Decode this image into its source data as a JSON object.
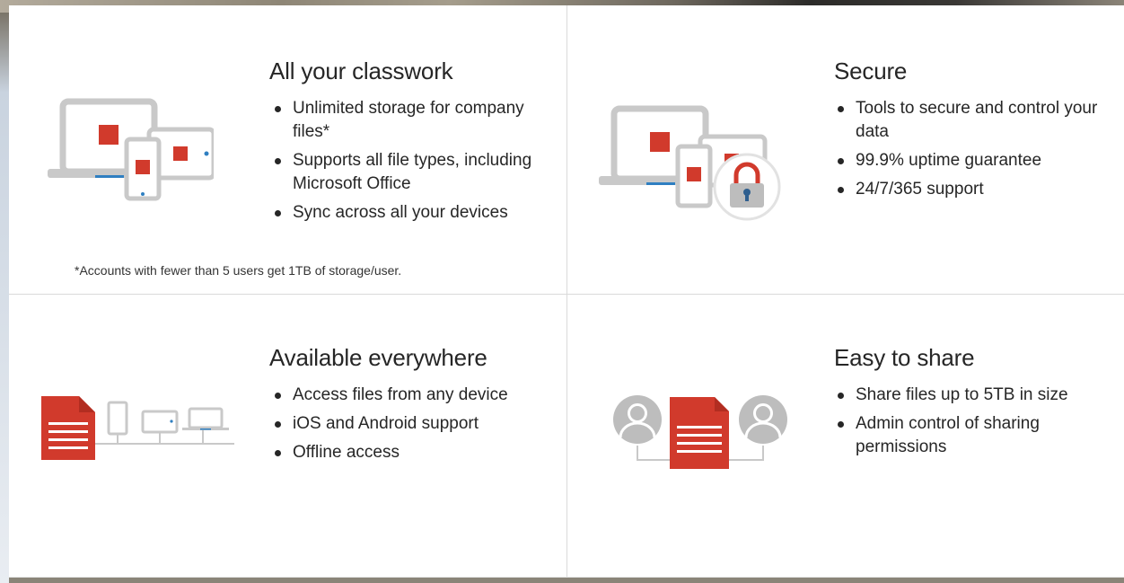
{
  "features": [
    {
      "title": "All your classwork",
      "icon": "devices-icon",
      "bullets": [
        "Unlimited storage for company files*",
        "Supports all file types, including Microsoft Office",
        "Sync across all your devices"
      ],
      "footnote": "*Accounts with fewer than 5 users get 1TB of storage/user."
    },
    {
      "title": "Secure",
      "icon": "devices-lock-icon",
      "bullets": [
        "Tools to secure and control your data",
        "99.9% uptime guarantee",
        "24/7/365 support"
      ]
    },
    {
      "title": "Available everywhere",
      "icon": "file-devices-icon",
      "bullets": [
        "Access files from any device",
        "iOS and Android support",
        "Offline access"
      ]
    },
    {
      "title": "Easy to share",
      "icon": "file-share-users-icon",
      "bullets": [
        "Share files up to 5TB in size",
        "Admin control of sharing permissions"
      ]
    }
  ],
  "colors": {
    "accent_red": "#d13a2c",
    "device_gray": "#c9c9c9",
    "accent_blue": "#2f7fc1"
  }
}
